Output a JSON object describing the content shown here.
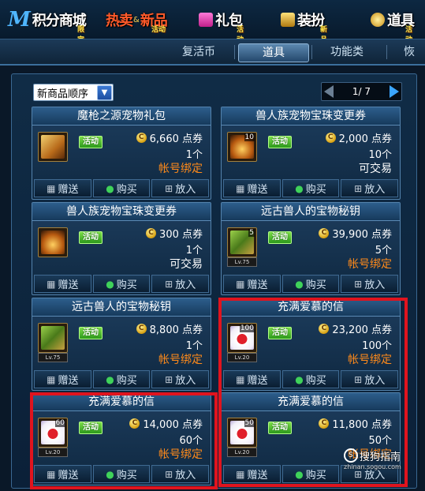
{
  "topnav": {
    "items": [
      {
        "label": "积分商城",
        "badge": "限定"
      },
      {
        "label": "热卖",
        "label2": "新品",
        "badge": "活动"
      },
      {
        "label": "礼包",
        "badge": "活动"
      },
      {
        "label": "装扮",
        "badge": "新品"
      },
      {
        "label": "道具",
        "badge": "活动"
      }
    ],
    "logo_letter": "M"
  },
  "tabs": {
    "items": [
      "复活币",
      "道具",
      "功能类",
      "恢"
    ],
    "active": "道具"
  },
  "sort": {
    "label": "新商品顺序",
    "arrow": "▼"
  },
  "pager": {
    "text": "1/ 7"
  },
  "items": [
    {
      "title": "魔枪之源宠物礼包",
      "tag": "活动",
      "price": "6,660 点券",
      "count": "1个",
      "note": "帐号绑定",
      "note_color": "orange",
      "icon": "pet-gift-box-icon",
      "qty": "",
      "level": ""
    },
    {
      "title": "兽人族宠物宝珠变更券",
      "tag": "活动",
      "price": "2,000 点券",
      "count": "10个",
      "note": "可交易",
      "note_color": "white",
      "icon": "orb-coupon-icon",
      "qty": "10",
      "level": ""
    },
    {
      "title": "兽人族宠物宝珠变更券",
      "tag": "活动",
      "price": "300 点券",
      "count": "1个",
      "note": "可交易",
      "note_color": "white",
      "icon": "orb-coupon-icon",
      "qty": "",
      "level": ""
    },
    {
      "title": "远古兽人的宝物秘钥",
      "tag": "活动",
      "price": "39,900 点券",
      "count": "5个",
      "note": "帐号绑定",
      "note_color": "orange",
      "icon": "treasure-key-icon",
      "qty": "5",
      "level": "Lv.75"
    },
    {
      "title": "远古兽人的宝物秘钥",
      "tag": "活动",
      "price": "8,800 点券",
      "count": "1个",
      "note": "帐号绑定",
      "note_color": "orange",
      "icon": "treasure-key-icon",
      "qty": "",
      "level": "Lv.75"
    },
    {
      "title": "充满爱慕的信",
      "tag": "活动",
      "price": "23,200 点券",
      "count": "100个",
      "note": "帐号绑定",
      "note_color": "orange",
      "icon": "love-letter-icon",
      "qty": "100",
      "level": "Lv.20"
    },
    {
      "title": "充满爱慕的信",
      "tag": "活动",
      "price": "14,000 点券",
      "count": "60个",
      "note": "帐号绑定",
      "note_color": "orange",
      "icon": "love-letter-icon",
      "qty": "60",
      "level": "Lv.20"
    },
    {
      "title": "充满爱慕的信",
      "tag": "活动",
      "price": "11,800 点券",
      "count": "50个",
      "note": "帐号绑定",
      "note_color": "orange",
      "icon": "love-letter-icon",
      "qty": "50",
      "level": "Lv.20"
    }
  ],
  "buttons": {
    "gift": "赠送",
    "buy": "购买",
    "cart": "放入"
  },
  "coin_symbol": "C",
  "watermark": {
    "text": "搜狗指南",
    "sub": "zhinan.sogou.com"
  },
  "colors": {
    "accent": "#ff8a1a",
    "tag_green": "#3fd25a",
    "highlight": "#e0141e"
  }
}
